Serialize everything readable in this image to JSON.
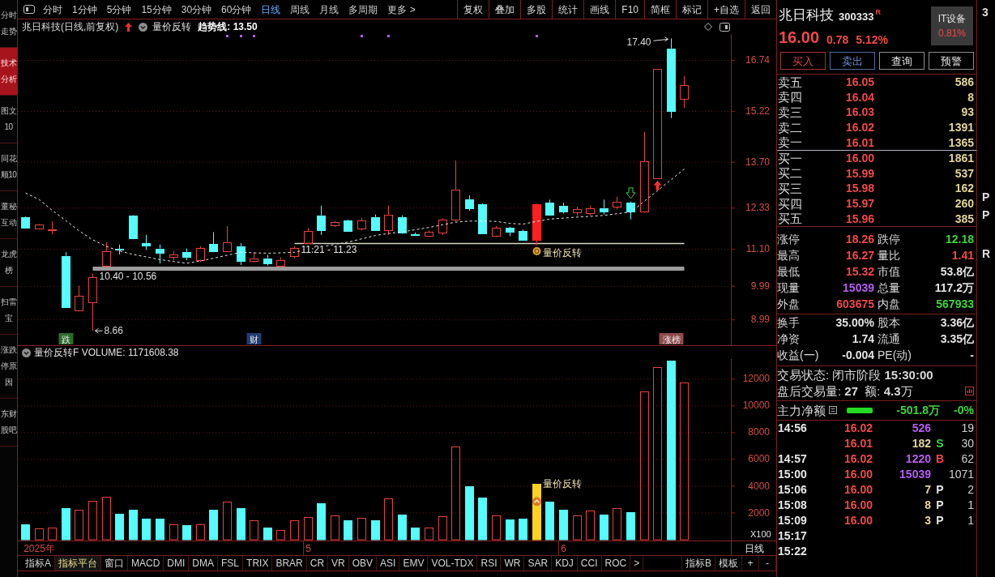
{
  "sidebar": {
    "items": [
      {
        "label": "分时走势",
        "selected": false
      },
      {
        "label": "技术分析",
        "selected": true
      },
      {
        "label": "图文10",
        "selected": false
      },
      {
        "label": "同花顺10",
        "selected": false
      },
      {
        "label": "董秘互动",
        "selected": false
      },
      {
        "label": "龙虎榜",
        "selected": false
      },
      {
        "label": "扫雷宝",
        "selected": false
      },
      {
        "label": "涨跌停原因",
        "selected": false
      },
      {
        "label": "东财股吧",
        "selected": false
      }
    ]
  },
  "toolbar": {
    "periods": [
      {
        "label": "分时",
        "selected": false
      },
      {
        "label": "1分钟",
        "selected": false
      },
      {
        "label": "5分钟",
        "selected": false
      },
      {
        "label": "15分钟",
        "selected": false
      },
      {
        "label": "30分钟",
        "selected": false
      },
      {
        "label": "60分钟",
        "selected": false
      },
      {
        "label": "日线",
        "selected": true
      },
      {
        "label": "周线",
        "selected": false
      },
      {
        "label": "月线",
        "selected": false
      },
      {
        "label": "多周期",
        "selected": false
      },
      {
        "label": "更多 >",
        "selected": false
      }
    ],
    "buttons": [
      "复权",
      "叠加",
      "多股",
      "统计",
      "画线",
      "F10",
      "简框",
      "标记",
      "+自选",
      "返回"
    ]
  },
  "chart": {
    "header": {
      "title": "兆日科技(日线,前复权)",
      "indicator": "量价反转",
      "trend": "趋势线: 13.50"
    },
    "volume_header": "量价反转F VOLUME: 1171608.38",
    "period_label": "日线",
    "tag_styles": [
      {
        "color": "#2d6b2d"
      },
      {
        "color": "#1f3d73"
      },
      {
        "color": "#8e4b4b"
      }
    ],
    "chart_data": [
      {
        "type": "candlestick",
        "ylim": [
          8.23,
          17.53
        ],
        "yticks": [
          8.99,
          9.99,
          {
            "value": 11.1,
            "label": "11.10"
          },
          12.33,
          {
            "value": 13.7,
            "label": "13.70"
          },
          15.22,
          16.74
        ],
        "grid": true,
        "categories": [
          null,
          null,
          null,
          "跌",
          null,
          null,
          null,
          null,
          null,
          null,
          null,
          null,
          null,
          null,
          null,
          null,
          null,
          "财",
          null,
          null,
          null,
          null,
          null,
          null,
          null,
          null,
          null,
          null,
          null,
          null,
          null,
          null,
          null,
          null,
          null,
          null,
          null,
          null,
          null,
          null,
          null,
          null,
          null,
          null,
          null,
          null,
          null,
          null,
          "涨榜",
          null
        ],
        "ohlc": [
          [
            12.06,
            12.08,
            11.72,
            11.74
          ],
          [
            11.72,
            11.85,
            11.7,
            11.83
          ],
          [
            11.66,
            11.93,
            11.55,
            11.7
          ],
          [
            10.9,
            11.01,
            9.36,
            9.38
          ],
          [
            9.26,
            10.01,
            9.24,
            9.7
          ],
          [
            9.51,
            10.37,
            8.66,
            10.26
          ],
          [
            10.61,
            11.31,
            10.58,
            11.05
          ],
          [
            11.1,
            11.24,
            10.94,
            11.09
          ],
          [
            12.11,
            12.12,
            11.4,
            11.42
          ],
          [
            11.27,
            11.53,
            11.08,
            11.22
          ],
          [
            11.12,
            11.24,
            10.67,
            11.0
          ],
          [
            10.86,
            11.04,
            10.77,
            10.95
          ],
          [
            11.02,
            11.12,
            10.77,
            10.86
          ],
          [
            10.78,
            11.19,
            10.71,
            11.13
          ],
          [
            11.25,
            11.61,
            11.01,
            11.05
          ],
          [
            11.04,
            11.79,
            11.03,
            11.31
          ],
          [
            11.19,
            11.28,
            10.63,
            10.74
          ],
          [
            10.74,
            11.01,
            10.71,
            10.83
          ],
          [
            10.83,
            10.93,
            10.61,
            10.68
          ],
          [
            10.61,
            10.86,
            10.56,
            10.78
          ],
          [
            10.89,
            11.19,
            10.83,
            11.13
          ],
          [
            11.28,
            11.73,
            11.24,
            11.64
          ],
          [
            12.11,
            12.4,
            11.53,
            11.68
          ],
          [
            11.82,
            11.94,
            11.76,
            11.91
          ],
          [
            11.96,
            11.98,
            11.62,
            11.64
          ],
          [
            11.72,
            12.03,
            11.66,
            11.96
          ],
          [
            12.06,
            12.14,
            11.66,
            11.68
          ],
          [
            11.66,
            12.4,
            11.53,
            12.14
          ],
          [
            12.06,
            12.11,
            11.56,
            11.59
          ],
          [
            11.54,
            11.6,
            11.5,
            11.52
          ],
          [
            11.49,
            11.66,
            11.47,
            11.61
          ],
          [
            11.59,
            12.03,
            11.53,
            11.99
          ],
          [
            11.99,
            13.75,
            11.92,
            12.89
          ],
          [
            12.58,
            12.71,
            12.25,
            12.33
          ],
          [
            12.44,
            12.47,
            11.55,
            11.57
          ],
          [
            11.51,
            11.79,
            11.46,
            11.74
          ],
          [
            11.74,
            11.77,
            11.49,
            11.62
          ],
          [
            11.64,
            11.69,
            11.36,
            11.39
          ],
          null,
          [
            12.49,
            12.58,
            12.1,
            12.14
          ],
          [
            12.4,
            12.49,
            12.17,
            12.22
          ],
          [
            12.19,
            12.37,
            12.1,
            12.29
          ],
          [
            12.17,
            12.4,
            12.11,
            12.33
          ],
          [
            12.33,
            12.58,
            12.14,
            12.22
          ],
          [
            12.37,
            12.67,
            12.29,
            12.52
          ],
          [
            12.49,
            12.52,
            11.99,
            12.22
          ],
          [
            12.22,
            14.6,
            12.19,
            13.73
          ],
          [
            13.22,
            16.48,
            13.2,
            16.48
          ],
          [
            17.1,
            17.4,
            15.02,
            15.22
          ],
          [
            15.6,
            16.27,
            15.32,
            16.0
          ]
        ],
        "series": [
          {
            "type": "line",
            "color": "#e8e8e8",
            "line_style": "dashed",
            "values": [
              12.78,
              12.58,
              12.26,
              11.95,
              11.65,
              11.38,
              11.18,
              11.05,
              10.94,
              10.87,
              10.79,
              10.73,
              10.68,
              10.75,
              10.83,
              10.92,
              11.01,
              10.99,
              10.98,
              10.99,
              11.01,
              11.09,
              11.17,
              11.24,
              11.31,
              11.41,
              11.51,
              11.57,
              11.62,
              11.68,
              11.75,
              11.83,
              11.91,
              11.94,
              11.94,
              11.93,
              11.87,
              11.85,
              11.93,
              12.0,
              12.03,
              12.06,
              12.08,
              12.11,
              12.16,
              12.21,
              12.54,
              12.85,
              13.18,
              13.5
            ]
          },
          {
            "type": "line",
            "name": "10.40 - 10.56",
            "color": "#9c9c9c",
            "values": [
              null,
              null,
              null,
              null,
              null,
              10.52,
              10.52,
              10.52,
              10.52,
              10.52,
              10.52,
              10.52,
              10.52,
              10.52,
              10.52,
              10.52,
              10.52,
              10.52,
              10.52,
              10.52,
              10.52,
              10.52,
              10.52,
              10.52,
              10.52,
              10.52,
              10.52,
              10.52,
              10.52,
              10.52,
              10.52,
              10.52,
              10.52,
              10.52,
              10.52,
              10.52,
              10.52,
              10.52,
              10.52,
              10.52,
              10.52,
              10.52,
              10.52,
              10.52,
              10.52,
              10.52,
              10.52,
              10.52,
              10.52,
              10.52
            ]
          },
          {
            "type": "line",
            "name": "11.21 - 11.23",
            "color": "#d8d6c4",
            "values": [
              null,
              null,
              null,
              null,
              null,
              null,
              null,
              null,
              null,
              null,
              null,
              null,
              null,
              null,
              null,
              null,
              null,
              null,
              null,
              null,
              11.27,
              11.27,
              11.27,
              11.27,
              11.27,
              11.27,
              11.27,
              11.27,
              11.27,
              11.27,
              11.27,
              11.27,
              11.27,
              11.27,
              11.27,
              11.27,
              11.27,
              11.27,
              11.27,
              11.27,
              11.27,
              11.27,
              11.27,
              11.27,
              11.27,
              11.27,
              11.27,
              11.27,
              11.27,
              11.27
            ]
          },
          {
            "type": "candlestick",
            "color": "#ff1f1f",
            "ohlc": [
              null,
              null,
              null,
              null,
              null,
              null,
              null,
              null,
              null,
              null,
              null,
              null,
              null,
              null,
              null,
              null,
              null,
              null,
              null,
              null,
              null,
              null,
              null,
              null,
              null,
              null,
              null,
              null,
              null,
              null,
              null,
              null,
              null,
              null,
              null,
              null,
              null,
              null,
              [
                11.39,
                12.46,
                11.21,
                12.44
              ],
              null,
              null,
              null,
              null,
              null,
              null,
              null,
              null,
              null,
              null,
              null
            ]
          }
        ],
        "annotations": [
          "17.40",
          "8.66",
          "量价反转"
        ]
      },
      {
        "type": "bar",
        "ylim": [
          0,
          13500
        ],
        "yticks": [
          2000,
          4000,
          6000,
          8000,
          10000,
          12000
        ],
        "ylabel": "X100",
        "grid": true,
        "categories": [
          null,
          "2025年",
          null,
          null,
          null,
          null,
          null,
          null,
          null,
          null,
          null,
          null,
          null,
          null,
          null,
          null,
          null,
          null,
          null,
          null,
          null,
          "5",
          null,
          null,
          null,
          null,
          null,
          null,
          null,
          null,
          null,
          null,
          null,
          null,
          null,
          null,
          null,
          null,
          null,
          null,
          "6",
          null,
          null,
          null,
          null,
          null,
          null,
          null,
          null,
          null
        ],
        "values": [
          1130,
          830,
          900,
          2340,
          2260,
          2900,
          3200,
          1960,
          2260,
          1550,
          1550,
          1130,
          1060,
          1170,
          2260,
          2830,
          2340,
          1430,
          900,
          720,
          1430,
          1700,
          2720,
          1810,
          1430,
          1620,
          1430,
          3100,
          1890,
          900,
          900,
          1740,
          6980,
          4000,
          3170,
          1810,
          1510,
          1590,
          4190,
          2870,
          2260,
          1810,
          2150,
          1890,
          2340,
          2080,
          11100,
          12870,
          13400,
          11720
        ],
        "colors": [
          "#54fcfc",
          "#e8413c",
          "#e8413c",
          "#54fcfc",
          "#e8413c",
          "#e8413c",
          "#e8413c",
          "#54fcfc",
          "#54fcfc",
          "#54fcfc",
          "#54fcfc",
          "#e8413c",
          "#54fcfc",
          "#e8413c",
          "#54fcfc",
          "#e8413c",
          "#54fcfc",
          "#e8413c",
          "#54fcfc",
          "#e8413c",
          "#e8413c",
          "#e8413c",
          "#54fcfc",
          "#e8413c",
          "#54fcfc",
          "#e8413c",
          "#54fcfc",
          "#e8413c",
          "#54fcfc",
          "#54fcfc",
          "#e8413c",
          "#e8413c",
          "#e8413c",
          "#54fcfc",
          "#54fcfc",
          "#e8413c",
          "#54fcfc",
          "#54fcfc",
          "#ffd21f",
          "#54fcfc",
          "#54fcfc",
          "#e8413c",
          "#e8413c",
          "#54fcfc",
          "#e8413c",
          "#54fcfc",
          "#e8413c",
          "#e8413c",
          "#54fcfc",
          "#e8413c"
        ],
        "annotations": [
          "量价反转"
        ]
      }
    ]
  },
  "indicator_bar": {
    "tabs": [
      {
        "label": "指标A",
        "selected": false
      },
      {
        "label": "指标平台",
        "selected": true
      },
      {
        "label": "窗口",
        "selected": false
      },
      {
        "label": "MACD",
        "selected": false
      },
      {
        "label": "DMI",
        "selected": false
      },
      {
        "label": "DMA",
        "selected": false
      },
      {
        "label": "FSL",
        "selected": false
      },
      {
        "label": "TRIX",
        "selected": false
      },
      {
        "label": "BRAR",
        "selected": false
      },
      {
        "label": "CR",
        "selected": false
      },
      {
        "label": "VR",
        "selected": false
      },
      {
        "label": "OBV",
        "selected": false
      },
      {
        "label": "ASI",
        "selected": false
      },
      {
        "label": "EMV",
        "selected": false
      },
      {
        "label": "VOL-TDX",
        "selected": false
      },
      {
        "label": "RSI",
        "selected": false
      },
      {
        "label": "WR",
        "selected": false
      },
      {
        "label": "SAR",
        "selected": false
      },
      {
        "label": "KDJ",
        "selected": false
      },
      {
        "label": "CCI",
        "selected": false
      },
      {
        "label": "ROC",
        "selected": false
      }
    ],
    "scroll": ">",
    "right_tabs": [
      {
        "label": "指标B",
        "selected": false
      },
      {
        "label": "模板",
        "selected": false
      }
    ],
    "buttons": [
      "+",
      "-"
    ]
  },
  "quote": {
    "name": "兆日科技",
    "code": "300333",
    "code_flag": "R",
    "sector": {
      "name": "IT设备",
      "change": "0.81%",
      "color": "#f24848"
    },
    "last": {
      "price": "16.00",
      "change": "0.78",
      "percent": "5.12%",
      "color": "#f24848"
    },
    "actions": [
      {
        "label": "买入",
        "kind": "buy"
      },
      {
        "label": "卖出",
        "kind": "sell"
      },
      {
        "label": "查询",
        "kind": "plain"
      },
      {
        "label": "预警",
        "kind": "plain"
      }
    ],
    "asks": [
      {
        "label": "卖五",
        "price": "16.05",
        "volume": "586"
      },
      {
        "label": "卖四",
        "price": "16.04",
        "volume": "8"
      },
      {
        "label": "卖三",
        "price": "16.03",
        "volume": "93"
      },
      {
        "label": "卖二",
        "price": "16.02",
        "volume": "1391"
      },
      {
        "label": "卖一",
        "price": "16.01",
        "volume": "1365"
      }
    ],
    "bids": [
      {
        "label": "买一",
        "price": "16.00",
        "volume": "1861"
      },
      {
        "label": "买二",
        "price": "15.99",
        "volume": "537"
      },
      {
        "label": "买三",
        "price": "15.98",
        "volume": "162"
      },
      {
        "label": "买四",
        "price": "15.97",
        "volume": "260"
      },
      {
        "label": "买五",
        "price": "15.96",
        "volume": "385"
      }
    ],
    "stats": [
      [
        {
          "label": "涨停",
          "value": "18.26",
          "color": "#f24848"
        },
        {
          "label": "跌停",
          "value": "12.18",
          "color": "#3dd43d"
        }
      ],
      [
        {
          "label": "最高",
          "value": "16.27",
          "color": "#f24848"
        },
        {
          "label": "量比",
          "value": "1.41",
          "color": "#f24848"
        }
      ],
      [
        {
          "label": "最低",
          "value": "15.32",
          "color": "#f24848"
        },
        {
          "label": "市值",
          "value": "53.8亿",
          "color": "#e4e4e4"
        }
      ],
      [
        {
          "label": "现量",
          "value": "15039",
          "color": "#b85cf2"
        },
        {
          "label": "总量",
          "value": "117.2万",
          "color": "#e4e4e4"
        }
      ],
      [
        {
          "label": "外盘",
          "value": "603675",
          "color": "#f24848"
        },
        {
          "label": "内盘",
          "value": "567933",
          "color": "#3dd43d"
        }
      ]
    ],
    "finance": [
      [
        {
          "label": "换手",
          "value": "35.00%",
          "color": "#e4e4e4"
        },
        {
          "label": "股本",
          "value": "3.36亿",
          "color": "#e4e4e4"
        }
      ],
      [
        {
          "label": "净资",
          "value": "1.74",
          "color": "#e4e4e4"
        },
        {
          "label": "流通",
          "value": "3.35亿",
          "color": "#e4e4e4"
        }
      ],
      [
        {
          "label": "收益(一)",
          "value": "-0.004",
          "color": "#e4e4e4"
        },
        {
          "label": "PE(动)",
          "value": "-",
          "color": "#e4e4e4"
        }
      ]
    ],
    "status": [
      "交易状态: 闭市阶段 **15:30:00**",
      "盘后交易量: **27**  额: **4.3**万"
    ],
    "net_flow": {
      "label": "主力净额",
      "value": "-501.8万",
      "percent": "-0%",
      "color": "#3dd43d"
    },
    "ticks": [
      {
        "time": "14:56",
        "price": "16.02",
        "volume": "526",
        "large": true,
        "count": "19"
      },
      {
        "price": "16.01",
        "volume": "182",
        "large": false,
        "flag": {
          "text": "S",
          "kind": "sell"
        },
        "count": "30"
      },
      {
        "time": "14:57",
        "price": "16.02",
        "volume": "1220",
        "large": true,
        "flag": {
          "text": "B",
          "kind": "buy"
        },
        "count": "62"
      },
      {
        "time": "15:00",
        "price": "16.00",
        "volume": "15039",
        "large": true,
        "count": "1071"
      },
      {
        "time": "15:06",
        "price": "16.00",
        "volume": "7",
        "large": false,
        "flag": {
          "text": "P",
          "kind": "neutral"
        },
        "count": "2"
      },
      {
        "time": "15:08",
        "price": "16.00",
        "volume": "8",
        "large": false,
        "flag": {
          "text": "P",
          "kind": "neutral"
        },
        "count": "1"
      },
      {
        "time": "15:09",
        "price": "16.00",
        "volume": "3",
        "large": false,
        "flag": {
          "text": "P",
          "kind": "neutral"
        },
        "count": "1"
      },
      {
        "time": "15:17"
      },
      {
        "time": "15:22"
      }
    ]
  },
  "edge_texts": [
    "3",
    "P",
    "P",
    "R"
  ]
}
